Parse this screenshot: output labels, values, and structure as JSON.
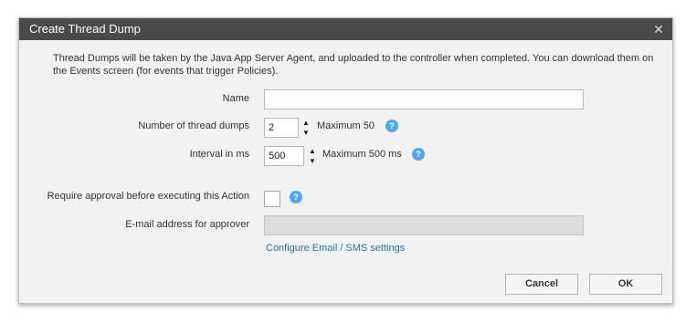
{
  "dialog": {
    "title": "Create Thread Dump",
    "close_icon": "close-icon",
    "description": "Thread Dumps will be taken by the Java App Server Agent, and uploaded to the controller when completed.  You can download them on the Events screen (for events that trigger Policies)."
  },
  "form": {
    "name": {
      "label": "Name",
      "value": ""
    },
    "thread_dumps": {
      "label": "Number of thread dumps",
      "value": "2",
      "max_text": "Maximum 50",
      "help": "?"
    },
    "interval": {
      "label": "Interval in ms",
      "value": "500",
      "max_text": "Maximum 500 ms",
      "help": "?"
    },
    "approval": {
      "label": "Require approval before executing this Action",
      "checked": false,
      "help": "?"
    },
    "approver_email": {
      "label": "E-mail address for approver",
      "value": ""
    },
    "configure_link": "Configure Email / SMS settings"
  },
  "buttons": {
    "cancel": "Cancel",
    "ok": "OK"
  },
  "colors": {
    "titlebar": "#4a4a4a",
    "help_accent": "#4ea6f4",
    "link": "#2b6fae",
    "dialog_bg": "#f2f2f2"
  }
}
